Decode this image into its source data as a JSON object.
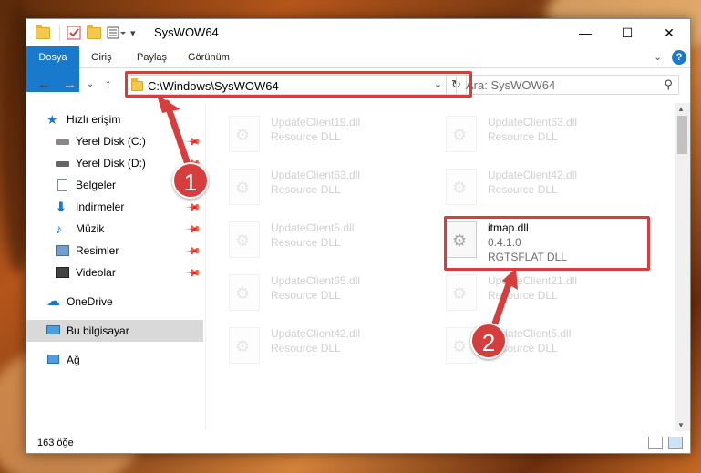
{
  "window": {
    "title": "SysWOW64"
  },
  "ribbon": {
    "tabs": [
      "Dosya",
      "Giriş",
      "Paylaş",
      "Görünüm"
    ],
    "help_label": "?"
  },
  "address": {
    "path": "C:\\Windows\\SysWOW64"
  },
  "search": {
    "placeholder": "Ara: SysWOW64"
  },
  "sidebar": {
    "items": [
      {
        "label": "Hızlı erişim",
        "icon": "star-icon"
      },
      {
        "label": "Yerel Disk (C:)",
        "icon": "drive-icon",
        "pinned": true
      },
      {
        "label": "Yerel Disk (D:)",
        "icon": "drive-icon",
        "pinned": true
      },
      {
        "label": "Belgeler",
        "icon": "document-icon",
        "pinned": true
      },
      {
        "label": "İndirmeler",
        "icon": "download-icon",
        "pinned": true
      },
      {
        "label": "Müzik",
        "icon": "music-icon",
        "pinned": true
      },
      {
        "label": "Resimler",
        "icon": "pictures-icon",
        "pinned": true
      },
      {
        "label": "Videolar",
        "icon": "video-icon",
        "pinned": true
      },
      {
        "label": "OneDrive",
        "icon": "cloud-icon"
      },
      {
        "label": "Bu bilgisayar",
        "icon": "computer-icon",
        "selected": true
      },
      {
        "label": "Ağ",
        "icon": "network-icon"
      }
    ]
  },
  "files": [
    {
      "name": "UpdateClient19.dll",
      "type": "Resource DLL",
      "faded": true
    },
    {
      "name": "UpdateClient63.dll",
      "type": "Resource DLL",
      "faded": true
    },
    {
      "name": "UpdateClient63.dll",
      "type": "Resource DLL",
      "faded": true
    },
    {
      "name": "UpdateClient42.dll",
      "type": "Resource DLL",
      "faded": true
    },
    {
      "name": "UpdateClient5.dll",
      "type": "Resource DLL",
      "faded": true
    },
    {
      "name": "itmap.dll",
      "version": "0.4.1.0",
      "type": "RGTSFLAT DLL",
      "faded": false
    },
    {
      "name": "UpdateClient65.dll",
      "type": "Resource DLL",
      "faded": true
    },
    {
      "name": "UpdateClient21.dll",
      "type": "Resource DLL",
      "faded": true
    },
    {
      "name": "UpdateClient42.dll",
      "type": "Resource DLL",
      "faded": true
    },
    {
      "name": "UpdateClient5.dll",
      "type": "Resource DLL",
      "faded": true
    }
  ],
  "status": {
    "count": "163 öğe"
  },
  "callouts": {
    "one": "1",
    "two": "2"
  },
  "colors": {
    "accent": "#1979ca",
    "highlight": "#d63d3d"
  }
}
